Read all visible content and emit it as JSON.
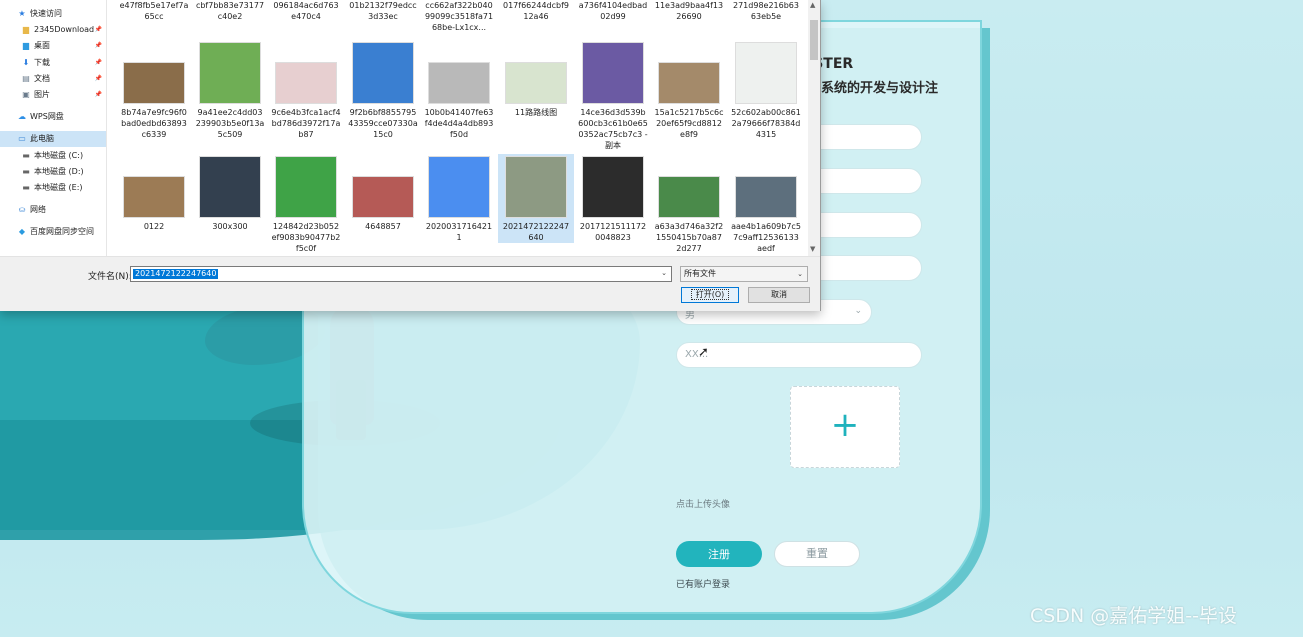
{
  "page": {
    "form_title": "ISTER",
    "form_subtitle": "理系统的开发与设计注",
    "select_value": "男",
    "field_placeholder": "XX...",
    "upload_plus": "+",
    "upload_hint": "点击上传头像",
    "register_button": "注册",
    "reset_button": "重置",
    "login_link": "已有账户登录",
    "watermark": "CSDN @嘉佑学姐--毕设"
  },
  "dialog": {
    "sidebar": [
      {
        "icon": "star-icon",
        "glyph": "★",
        "label": "快速访问",
        "pinned": false,
        "selected": false
      },
      {
        "icon": "folder-icon",
        "glyph": "▆",
        "label": "2345Download",
        "pinned": true,
        "selected": false
      },
      {
        "icon": "desktop-icon",
        "glyph": "▆",
        "label": "桌面",
        "pinned": true,
        "selected": false
      },
      {
        "icon": "download-icon",
        "glyph": "⬇",
        "label": "下载",
        "pinned": true,
        "selected": false
      },
      {
        "icon": "document-icon",
        "glyph": "▤",
        "label": "文档",
        "pinned": true,
        "selected": false
      },
      {
        "icon": "picture-icon",
        "glyph": "▣",
        "label": "图片",
        "pinned": true,
        "selected": false
      },
      {
        "icon": "cloud-icon",
        "glyph": "☁",
        "label": "WPS网盘",
        "pinned": false,
        "selected": false
      },
      {
        "icon": "computer-icon",
        "glyph": "▭",
        "label": "此电脑",
        "pinned": false,
        "selected": true
      },
      {
        "icon": "drive-icon",
        "glyph": "▬",
        "label": "本地磁盘 (C:)",
        "pinned": false,
        "selected": false
      },
      {
        "icon": "drive-icon",
        "glyph": "▬",
        "label": "本地磁盘 (D:)",
        "pinned": false,
        "selected": false
      },
      {
        "icon": "drive-icon",
        "glyph": "▬",
        "label": "本地磁盘 (E:)",
        "pinned": false,
        "selected": false
      },
      {
        "icon": "network-icon",
        "glyph": "⛀",
        "label": "网络",
        "pinned": false,
        "selected": false
      },
      {
        "icon": "baidu-sync-icon",
        "glyph": "◆",
        "label": "百度网盘同步空间",
        "pinned": false,
        "selected": false
      }
    ],
    "files_row1": [
      "e47f8fb5e17ef7a65cc",
      "cbf7bb83e73177c40e2",
      "096184ac6d763e470c4",
      "01b2132f79edcc3d33ec",
      "cc662af322b04099099c3518fa7168be-Lx1cx...",
      "017f66244dcbf912a46",
      "a736f4104edbad02d99",
      "11e3ad9baa4f1326690",
      "271d98e216b6363eb5e"
    ],
    "files_row2": [
      {
        "name": "8b74a7e9fc96f0bad0edbd63893c6339",
        "color": "#8a6d4a"
      },
      {
        "name": "9a41ee2c4dd03239903b5e0f13a5c509",
        "color": "#6fae55"
      },
      {
        "name": "9c6e4b3fca1acf4bd786d3972f17ab87",
        "color": "#e7cfd0"
      },
      {
        "name": "9f2b6bf885579543359cce07330a15c0",
        "color": "#3a7fd1"
      },
      {
        "name": "10b0b41407fe63f4de4d4a4db893f50d",
        "color": "#b9b9b9"
      },
      {
        "name": "11路路线图",
        "color": "#d8e4cf"
      },
      {
        "name": "14ce36d3d539b600cb3c61b0e650352ac75cb7c3 - 副本",
        "color": "#6b5aa3"
      },
      {
        "name": "15a1c5217b5c6c20ef65f9cd8812e8f9",
        "color": "#a48a6a"
      },
      {
        "name": "52c602ab00c8612a79666f78384d4315",
        "color": "#eef1ef"
      }
    ],
    "files_row3": [
      {
        "name": "0122",
        "color": "#9c7b55"
      },
      {
        "name": "300x300",
        "color": "#33404f"
      },
      {
        "name": "124842d23b052ef9083b90477b2f5c0f",
        "color": "#3fa347"
      },
      {
        "name": "4648857",
        "color": "#b55a56"
      },
      {
        "name": "20200317164211",
        "color": "#4b8ef0"
      },
      {
        "name": "2021472122247640",
        "color": "#8d9a83"
      },
      {
        "name": "20171215111720048823",
        "color": "#2c2c2c"
      },
      {
        "name": "a63a3d746a32f21550415b70a872d277",
        "color": "#4a8a4a"
      },
      {
        "name": "aae4b1a609b7c57c9aff12536133aedf",
        "color": "#5d6f7d"
      }
    ],
    "filename_label": "文件名(N):",
    "filename_value": "2021472122247640",
    "filetype_value": "所有文件",
    "open_button": "打开(O)",
    "cancel_button": "取消"
  }
}
